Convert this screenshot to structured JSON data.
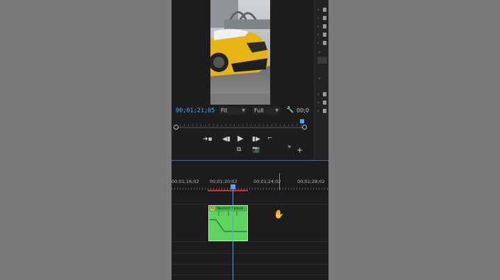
{
  "program_monitor": {
    "timecode": "00;01;21;05",
    "fit_label": "Fit",
    "quality_label": "Full",
    "duration_label": "00;0",
    "playhead_fraction": 0.97
  },
  "timeline": {
    "ruler_labels": [
      "00;01;16;02",
      "00;01;20;02",
      "00;01;24;02",
      "00;01;28;02"
    ],
    "clip": {
      "name": "Nested Seque",
      "fx_badge": "fx"
    }
  },
  "colors": {
    "accent_blue": "#4aa3ff",
    "clip_green": "#5ed45e",
    "workarea_red": "#d83030"
  }
}
